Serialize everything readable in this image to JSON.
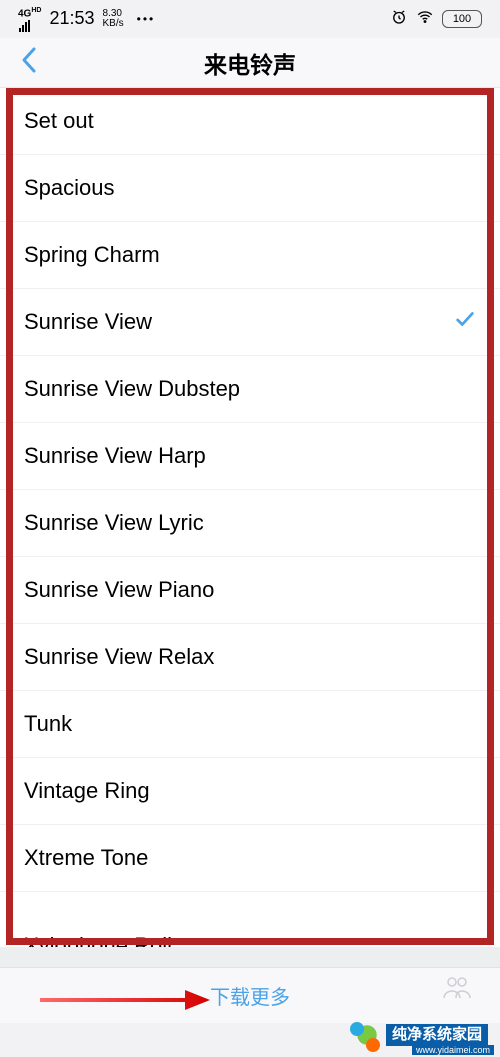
{
  "statusBar": {
    "network4g": "4G",
    "hd": "HD",
    "time": "21:53",
    "speedNum": "8.30",
    "speedUnit": "KB/s",
    "dots": "•••",
    "battery": "100"
  },
  "header": {
    "back": "‹",
    "title": "来电铃声"
  },
  "ringtones": [
    {
      "name": "Set out",
      "selected": false
    },
    {
      "name": "Spacious",
      "selected": false
    },
    {
      "name": "Spring Charm",
      "selected": false
    },
    {
      "name": "Sunrise View",
      "selected": true
    },
    {
      "name": "Sunrise View Dubstep",
      "selected": false
    },
    {
      "name": "Sunrise View Harp",
      "selected": false
    },
    {
      "name": "Sunrise View Lyric",
      "selected": false
    },
    {
      "name": "Sunrise View Piano",
      "selected": false
    },
    {
      "name": "Sunrise View Relax",
      "selected": false
    },
    {
      "name": "Tunk",
      "selected": false
    },
    {
      "name": "Vintage Ring",
      "selected": false
    },
    {
      "name": "Xtreme Tone",
      "selected": false
    },
    {
      "name": "Xylophone Roll",
      "selected": false
    }
  ],
  "footer": {
    "downloadMore": "下载更多"
  },
  "watermark": {
    "text": "纯净系统家园",
    "url": "www.yidaimei.com"
  },
  "annotation": {
    "hasRedBox": true,
    "hasArrow": true
  }
}
